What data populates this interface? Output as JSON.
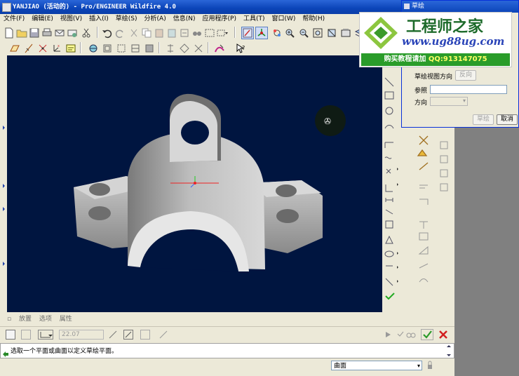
{
  "window": {
    "title": "YANJIAO (活动的) - Pro/ENGINEER Wildfire 4.0"
  },
  "menu": [
    "文件(F)",
    "编辑(E)",
    "视图(V)",
    "插入(I)",
    "草绘(S)",
    "分析(A)",
    "信息(N)",
    "应用程序(P)",
    "工具(T)",
    "窗口(W)",
    "帮助(H)"
  ],
  "dashboard_tabs": [
    "放置",
    "选项",
    "属性"
  ],
  "dashboard": {
    "depth_value": "22.07"
  },
  "message": "选取一个平面或曲面以定义草绘平面。",
  "status": {
    "filter_value": "曲面"
  },
  "sketch_dialog": {
    "title": "草绘",
    "orientation_label": "草绘视图方向",
    "flip_button": "反向",
    "reference_label": "参照",
    "direction_label": "方向",
    "sketch_button": "草绘",
    "cancel_button": "取消"
  },
  "watermark": {
    "title": "工程师之家",
    "url": "www.ug88ug.com",
    "notice": "购买教程请加",
    "qq": "QQ:913147075"
  },
  "colors": {
    "viewport_bg": "#001540",
    "model_shade": "#c8c8c8",
    "accept_green": "#2a9a2a",
    "cancel_red": "#d22020"
  }
}
